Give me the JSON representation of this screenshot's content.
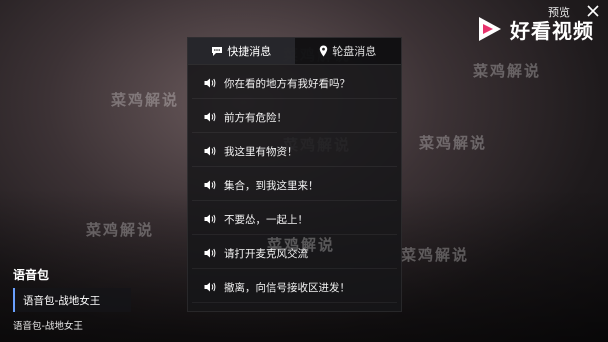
{
  "watermark": "菜鸡解说",
  "brand": {
    "preview": "预览",
    "name": "好看视频"
  },
  "tabs": [
    {
      "label": "快捷消息",
      "icon": "chat-bubble-icon",
      "active": true
    },
    {
      "label": "轮盘消息",
      "icon": "location-pin-icon",
      "active": false
    }
  ],
  "messages": [
    "你在看的地方有我好看吗？",
    "前方有危险！",
    "我这里有物资！",
    "集合，到我这里来！",
    "不要怂，一起上！",
    "请打开麦克风交流",
    "撤离，向信号接收区进发！"
  ],
  "voice_pack": {
    "title": "语音包",
    "selected": "语音包-战地女王",
    "caption": "语音包-战地女王"
  },
  "colors": {
    "accent": "#6aa0ff"
  }
}
